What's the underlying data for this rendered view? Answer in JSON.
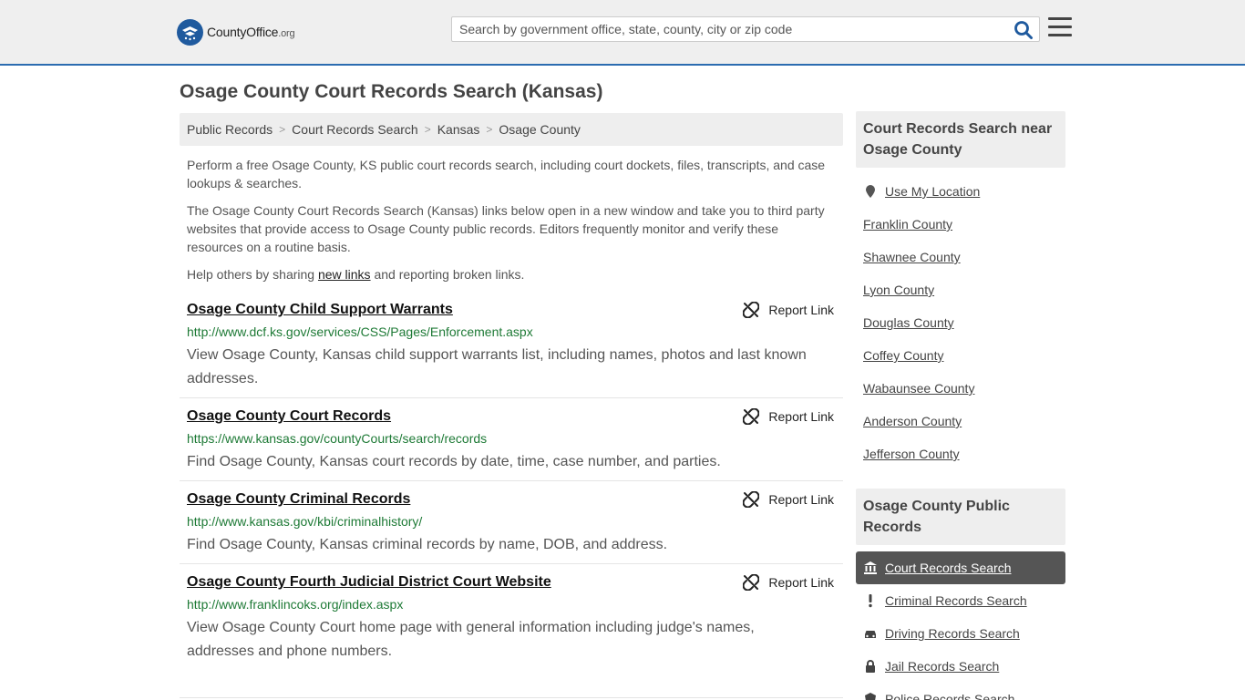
{
  "header": {
    "logo_main": "CountyOffice",
    "logo_suffix": ".org",
    "search_placeholder": "Search by government office, state, county, city or zip code"
  },
  "page": {
    "title": "Osage County Court Records Search (Kansas)"
  },
  "breadcrumb": [
    "Public Records",
    "Court Records Search",
    "Kansas",
    "Osage County"
  ],
  "intro": {
    "p1": "Perform a free Osage County, KS public court records search, including court dockets, files, transcripts, and case lookups & searches.",
    "p2": "The Osage County Court Records Search (Kansas) links below open in a new window and take you to third party websites that provide access to Osage County public records. Editors frequently monitor and verify these resources on a routine basis.",
    "p3_before": "Help others by sharing ",
    "p3_link": "new links",
    "p3_after": " and reporting broken links."
  },
  "report_label": "Report Link",
  "results": [
    {
      "title": "Osage County Child Support Warrants",
      "url": "http://www.dcf.ks.gov/services/CSS/Pages/Enforcement.aspx",
      "desc": "View Osage County, Kansas child support warrants list, including names, photos and last known addresses."
    },
    {
      "title": "Osage County Court Records",
      "url": "https://www.kansas.gov/countyCourts/search/records",
      "desc": "Find Osage County, Kansas court records by date, time, case number, and parties."
    },
    {
      "title": "Osage County Criminal Records",
      "url": "http://www.kansas.gov/kbi/criminalhistory/",
      "desc": "Find Osage County, Kansas criminal records by name, DOB, and address."
    },
    {
      "title": "Osage County Fourth Judicial District Court Website",
      "url": "http://www.franklincoks.org/index.aspx",
      "desc": "View Osage County Court home page with general information including judge's names, addresses and phone numbers."
    }
  ],
  "sidebar": {
    "nearby_heading": "Court Records Search near Osage County",
    "use_location": "Use My Location",
    "nearby": [
      "Franklin County",
      "Shawnee County",
      "Lyon County",
      "Douglas County",
      "Coffey County",
      "Wabaunsee County",
      "Anderson County",
      "Jefferson County"
    ],
    "public_heading": "Osage County Public Records",
    "public_items": [
      {
        "label": "Court Records Search",
        "icon": "courthouse-icon",
        "active": true
      },
      {
        "label": "Criminal Records Search",
        "icon": "exclamation-icon",
        "active": false
      },
      {
        "label": "Driving Records Search",
        "icon": "car-icon",
        "active": false
      },
      {
        "label": "Jail Records Search",
        "icon": "lock-icon",
        "active": false
      },
      {
        "label": "Police Records Search",
        "icon": "badge-icon",
        "active": false
      }
    ]
  },
  "colors": {
    "header_bg": "#efefef",
    "header_border": "#2b6cb0",
    "url_green": "#1e7a36",
    "active_bg": "#555555",
    "search_icon": "#1f5a9e"
  }
}
